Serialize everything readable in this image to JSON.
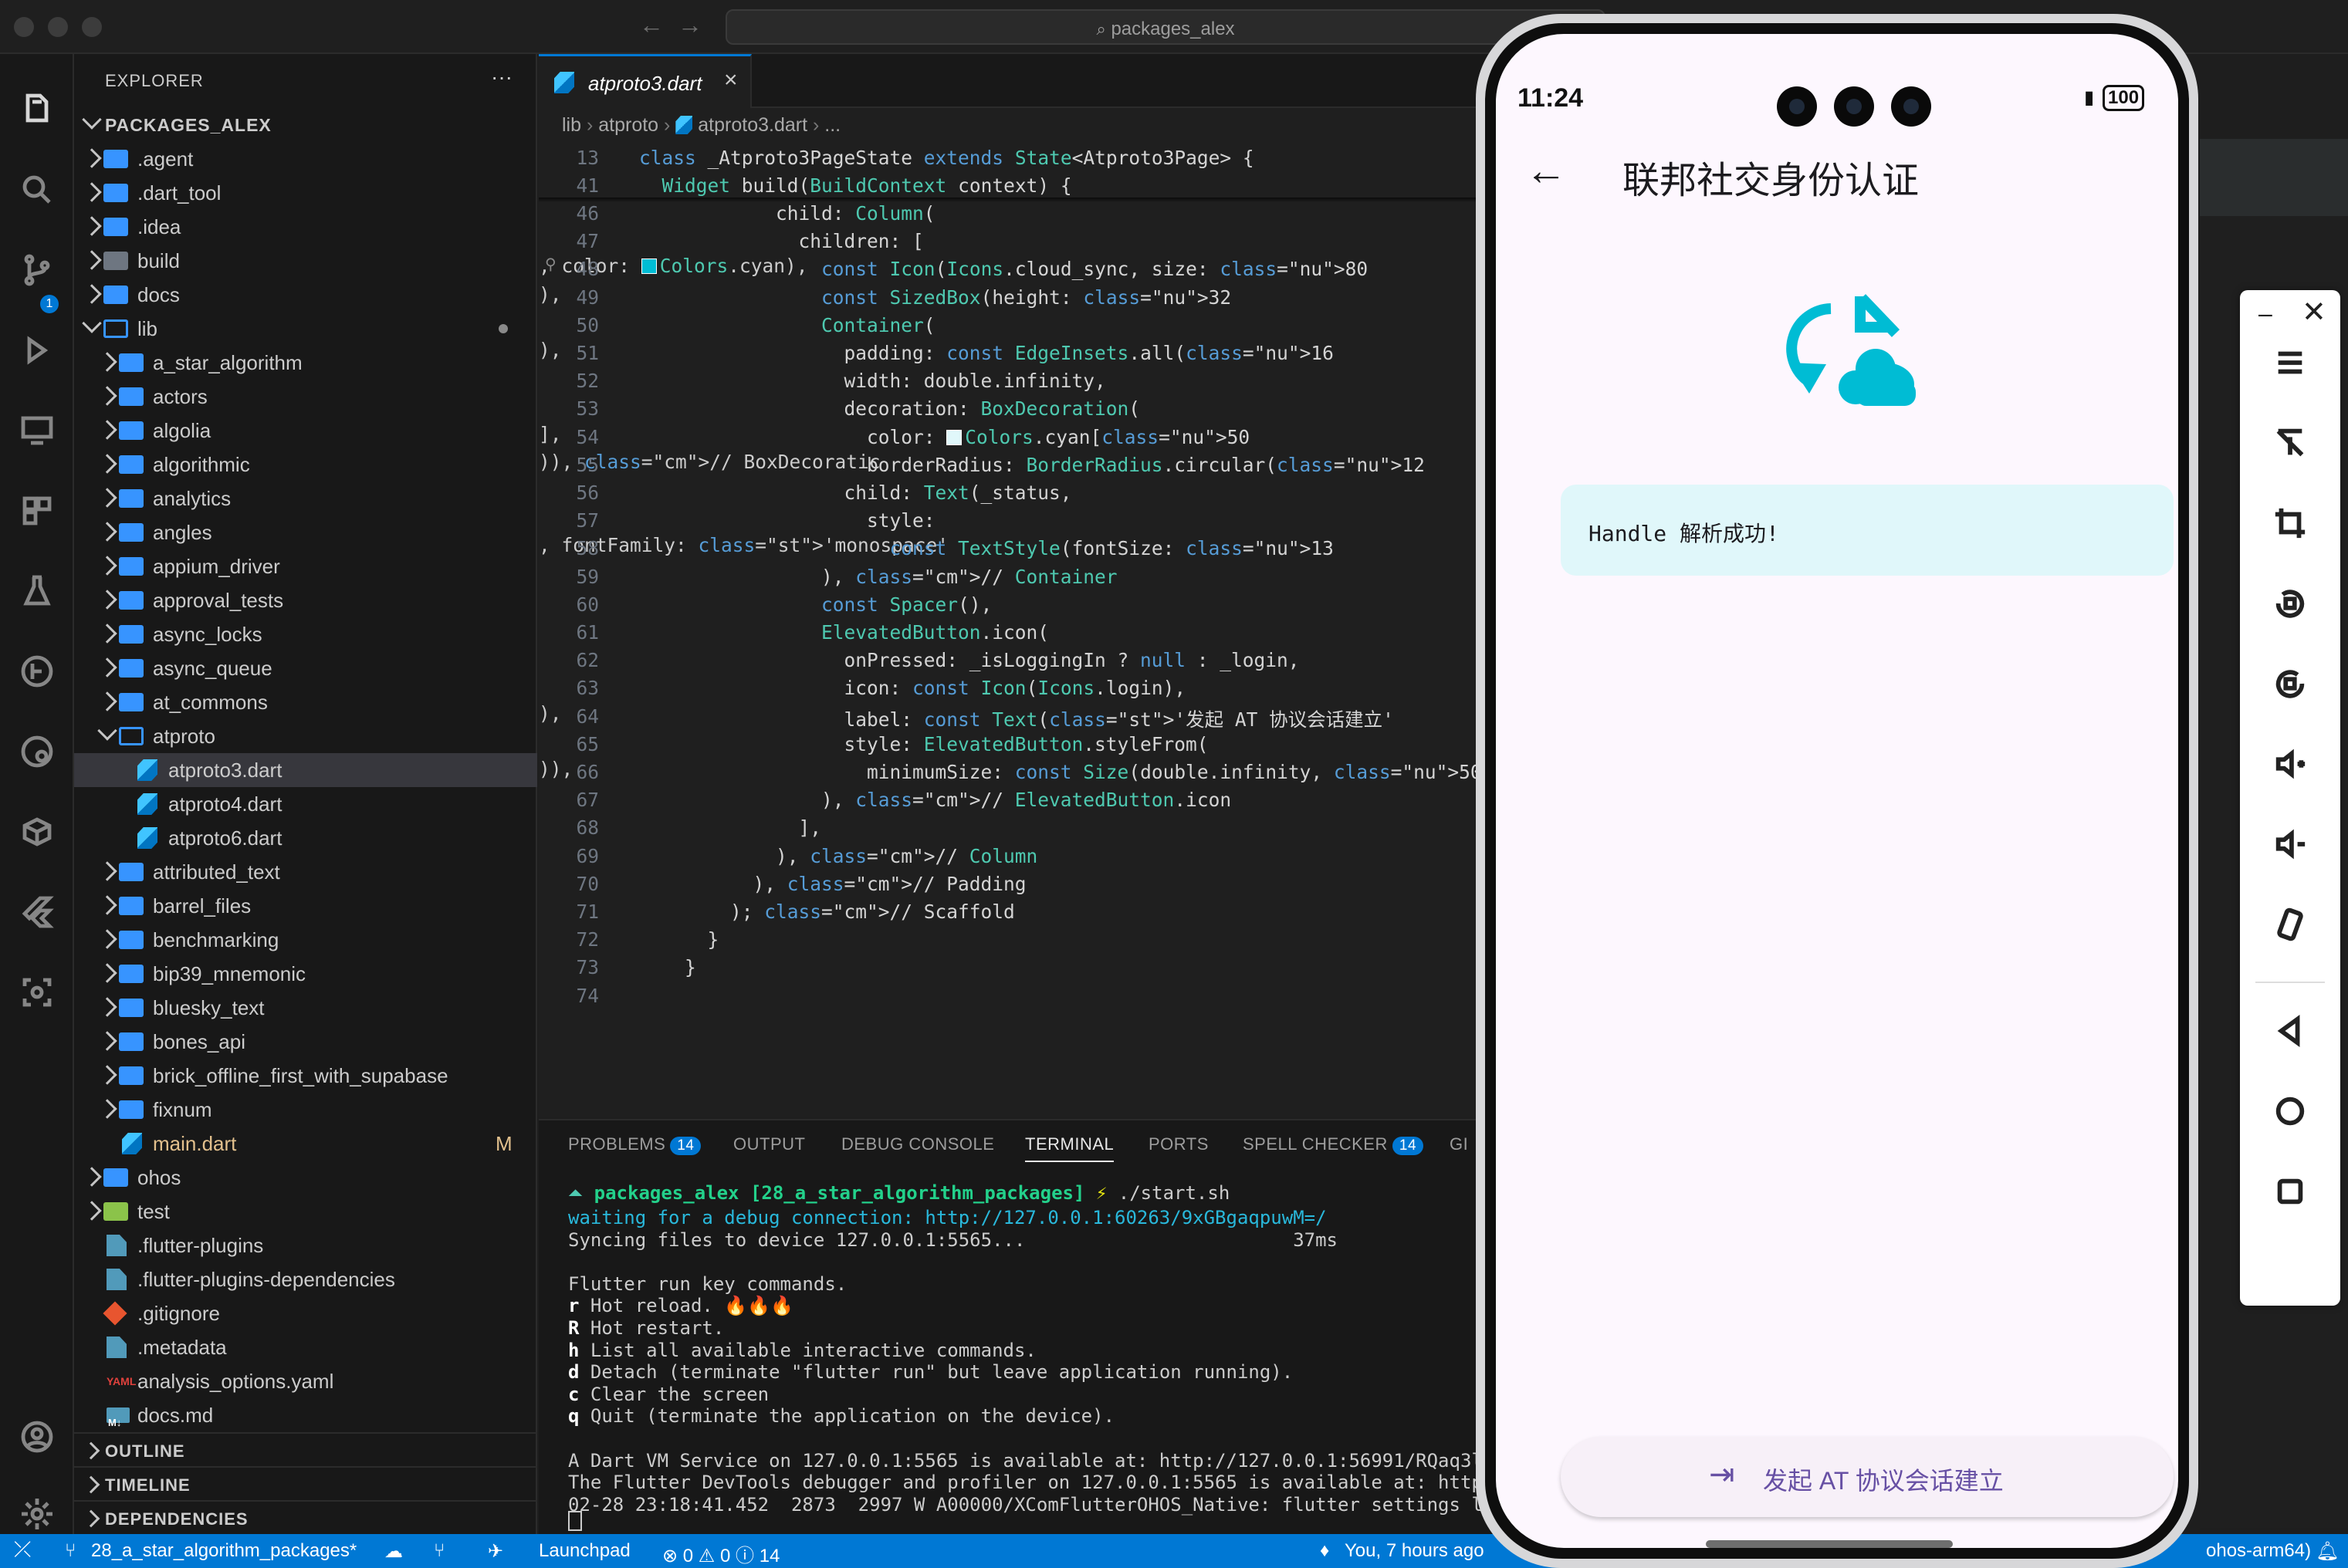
{
  "window": {
    "search_text": "packages_alex"
  },
  "sidebar": {
    "title": "EXPLORER",
    "root": "PACKAGES_ALEX",
    "items": [
      {
        "label": ".agent",
        "type": "folder",
        "depth": 0,
        "state": "closed"
      },
      {
        "label": ".dart_tool",
        "type": "folder",
        "depth": 0,
        "state": "closed"
      },
      {
        "label": ".idea",
        "type": "folder",
        "depth": 0,
        "state": "closed"
      },
      {
        "label": "build",
        "type": "folder-tool",
        "depth": 0,
        "state": "closed"
      },
      {
        "label": "docs",
        "type": "folder",
        "depth": 0,
        "state": "closed"
      },
      {
        "label": "lib",
        "type": "folder",
        "depth": 0,
        "state": "open"
      },
      {
        "label": "a_star_algorithm",
        "type": "folder",
        "depth": 1,
        "state": "closed"
      },
      {
        "label": "actors",
        "type": "folder",
        "depth": 1,
        "state": "closed"
      },
      {
        "label": "algolia",
        "type": "folder",
        "depth": 1,
        "state": "closed"
      },
      {
        "label": "algorithmic",
        "type": "folder",
        "depth": 1,
        "state": "closed"
      },
      {
        "label": "analytics",
        "type": "folder",
        "depth": 1,
        "state": "closed"
      },
      {
        "label": "angles",
        "type": "folder",
        "depth": 1,
        "state": "closed"
      },
      {
        "label": "appium_driver",
        "type": "folder",
        "depth": 1,
        "state": "closed"
      },
      {
        "label": "approval_tests",
        "type": "folder",
        "depth": 1,
        "state": "closed"
      },
      {
        "label": "async_locks",
        "type": "folder",
        "depth": 1,
        "state": "closed"
      },
      {
        "label": "async_queue",
        "type": "folder",
        "depth": 1,
        "state": "closed"
      },
      {
        "label": "at_commons",
        "type": "folder",
        "depth": 1,
        "state": "closed"
      },
      {
        "label": "atproto",
        "type": "folder",
        "depth": 1,
        "state": "open"
      },
      {
        "label": "atproto3.dart",
        "type": "dart",
        "depth": 2,
        "state": "selected"
      },
      {
        "label": "atproto4.dart",
        "type": "dart",
        "depth": 2,
        "state": ""
      },
      {
        "label": "atproto6.dart",
        "type": "dart",
        "depth": 2,
        "state": ""
      },
      {
        "label": "attributed_text",
        "type": "folder",
        "depth": 1,
        "state": "closed"
      },
      {
        "label": "barrel_files",
        "type": "folder",
        "depth": 1,
        "state": "closed"
      },
      {
        "label": "benchmarking",
        "type": "folder",
        "depth": 1,
        "state": "closed"
      },
      {
        "label": "bip39_mnemonic",
        "type": "folder",
        "depth": 1,
        "state": "closed"
      },
      {
        "label": "bluesky_text",
        "type": "folder",
        "depth": 1,
        "state": "closed"
      },
      {
        "label": "bones_api",
        "type": "folder",
        "depth": 1,
        "state": "closed"
      },
      {
        "label": "brick_offline_first_with_supabase",
        "type": "folder",
        "depth": 1,
        "state": "closed"
      },
      {
        "label": "fixnum",
        "type": "folder",
        "depth": 1,
        "state": "closed"
      },
      {
        "label": "main.dart",
        "type": "dart",
        "depth": 1,
        "state": "modified"
      },
      {
        "label": "ohos",
        "type": "folder",
        "depth": 0,
        "state": "closed"
      },
      {
        "label": "test",
        "type": "folder-test",
        "depth": 0,
        "state": "closed"
      },
      {
        "label": ".flutter-plugins",
        "type": "file",
        "depth": 0,
        "state": ""
      },
      {
        "label": ".flutter-plugins-dependencies",
        "type": "file",
        "depth": 0,
        "state": ""
      },
      {
        "label": ".gitignore",
        "type": "git",
        "depth": 0,
        "state": ""
      },
      {
        "label": ".metadata",
        "type": "file",
        "depth": 0,
        "state": ""
      },
      {
        "label": "analysis_options.yaml",
        "type": "yaml",
        "depth": 0,
        "state": ""
      },
      {
        "label": "docs.md",
        "type": "md",
        "depth": 0,
        "state": ""
      }
    ],
    "modified_marker": "M",
    "sections": [
      "OUTLINE",
      "TIMELINE",
      "DEPENDENCIES"
    ]
  },
  "editor": {
    "tab": "atproto3.dart",
    "breadcrumb": [
      "lib",
      "atproto",
      "atproto3.dart",
      "..."
    ],
    "sticky": [
      {
        "ln": "13",
        "code": "class _Atproto3PageState extends State<Atproto3Page> {"
      },
      {
        "ln": "41",
        "code": "  Widget build(BuildContext context) {"
      }
    ],
    "lines": [
      {
        "ln": "46",
        "html": "            child: Column("
      },
      {
        "ln": "47",
        "html": "              children: ["
      },
      {
        "ln": "48",
        "html": "                const Icon(Icons.cloud_sync, size: 80, color: ■Colors.cyan),"
      },
      {
        "ln": "49",
        "html": "                const SizedBox(height: 32),"
      },
      {
        "ln": "50",
        "html": "                Container("
      },
      {
        "ln": "51",
        "html": "                  padding: const EdgeInsets.all(16),"
      },
      {
        "ln": "52",
        "html": "                  width: double.infinity,"
      },
      {
        "ln": "53",
        "html": "                  decoration: BoxDecoration("
      },
      {
        "ln": "54",
        "html": "                    color: ■Colors.cyan[50],"
      },
      {
        "ln": "55",
        "html": "                    borderRadius: BorderRadius.circular(12)), // BoxDecoratic"
      },
      {
        "ln": "56",
        "html": "                  child: Text(_status,"
      },
      {
        "ln": "57",
        "html": "                    style:"
      },
      {
        "ln": "58",
        "html": "                      const TextStyle(fontSize: 13, fontFamily: 'monospace'"
      },
      {
        "ln": "59",
        "html": "                ), // Container"
      },
      {
        "ln": "60",
        "html": "                const Spacer(),"
      },
      {
        "ln": "61",
        "html": "                ElevatedButton.icon("
      },
      {
        "ln": "62",
        "html": "                  onPressed: _isLoggingIn ? null : _login,"
      },
      {
        "ln": "63",
        "html": "                  icon: const Icon(Icons.login),"
      },
      {
        "ln": "64",
        "html": "                  label: const Text('发起 AT 协议会话建立'),"
      },
      {
        "ln": "65",
        "html": "                  style: ElevatedButton.styleFrom("
      },
      {
        "ln": "66",
        "html": "                    minimumSize: const Size(double.infinity, 50)),"
      },
      {
        "ln": "67",
        "html": "                ), // ElevatedButton.icon"
      },
      {
        "ln": "68",
        "html": "              ],"
      },
      {
        "ln": "69",
        "html": "            ), // Column"
      },
      {
        "ln": "70",
        "html": "          ), // Padding"
      },
      {
        "ln": "71",
        "html": "        ); // Scaffold"
      },
      {
        "ln": "72",
        "html": "      }"
      },
      {
        "ln": "73",
        "html": "    }"
      },
      {
        "ln": "74",
        "html": ""
      }
    ]
  },
  "panel": {
    "tabs": [
      {
        "label": "PROBLEMS",
        "badge": "14"
      },
      {
        "label": "OUTPUT",
        "badge": ""
      },
      {
        "label": "DEBUG CONSOLE",
        "badge": ""
      },
      {
        "label": "TERMINAL",
        "badge": ""
      },
      {
        "label": "PORTS",
        "badge": ""
      },
      {
        "label": "SPELL CHECKER",
        "badge": "14"
      },
      {
        "label": "GI",
        "badge": ""
      }
    ],
    "prompt_dir": "packages_alex [28_a_star_algorithm_packages]",
    "prompt_cmd": "./start.sh",
    "terminal": [
      "waiting for a debug connection: http://127.0.0.1:60263/9xGBgaqpuwM=/",
      "Syncing files to device 127.0.0.1:5565...                        37ms",
      "",
      "Flutter run key commands.",
      "r Hot reload. 🔥🔥🔥",
      "R Hot restart.",
      "h List all available interactive commands.",
      "d Detach (terminate \"flutter run\" but leave application running).",
      "c Clear the screen",
      "q Quit (terminate the application on the device).",
      "",
      "A Dart VM Service on 127.0.0.1:5565 is available at: http://127.0.0.1:56991/RQaq3ltx",
      "The Flutter DevTools debugger and profiler on 127.0.0.1:5565 is available at: http:/",
      "02-28 23:18:41.452  2873  2997 W A00000/XComFlutterOHOS_Native: flutter settings log"
    ]
  },
  "statusbar": {
    "branch": "28_a_star_algorithm_packages*",
    "launchpad": "Launchpad",
    "errors": "0",
    "warnings": "0",
    "infos": "14",
    "blame": "You, 7 hours ago",
    "device": "ohos-arm64)"
  },
  "phone": {
    "time": "11:24",
    "battery": "100",
    "title": "联邦社交身份认证",
    "status_text": "Handle 解析成功!",
    "button_label": "发起 AT 协议会话建立",
    "accent": "#00bcd4",
    "button_text_color": "#6750a4",
    "status_bg": "#e0f7fa"
  }
}
